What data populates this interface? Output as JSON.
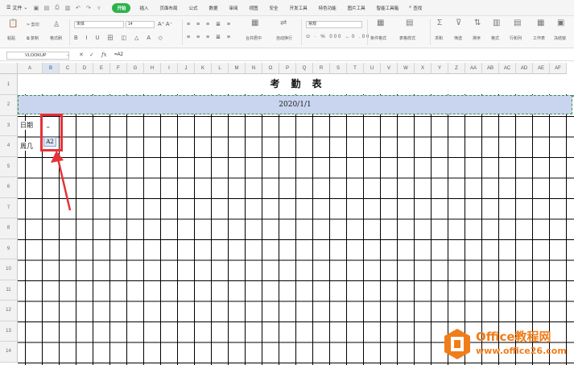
{
  "menubar": {
    "file_label": "文件",
    "tabs": [
      "开始",
      "插入",
      "页面布局",
      "公式",
      "数据",
      "审阅",
      "视图",
      "安全",
      "开发工具",
      "特色功能",
      "图片工具",
      "智能工具箱"
    ],
    "active_tab_index": 0,
    "search_label": "查找"
  },
  "ribbon": {
    "paste_label": "粘贴",
    "cut_label": "剪切",
    "copy_label": "复制",
    "format_painter_label": "格式刷",
    "font_name": "宋体",
    "font_size": "14",
    "merge_label": "合并居中",
    "wrap_label": "自动换行",
    "number_format": "常规",
    "cond_format_label": "条件格式",
    "table_style_label": "表格样式",
    "sum_label": "求和",
    "filter_label": "筛选",
    "sort_label": "排序",
    "format_label": "格式",
    "rowcol_label": "行和列",
    "worksheet_label": "工作表",
    "freeze_label": "冻结窗"
  },
  "formula_bar": {
    "name_box": "VLOOKUP",
    "formula": "=A2"
  },
  "columns": [
    "A",
    "B",
    "C",
    "D",
    "E",
    "F",
    "G",
    "H",
    "I",
    "J",
    "K",
    "L",
    "M",
    "N",
    "O",
    "P",
    "Q",
    "R",
    "S",
    "T",
    "U",
    "V",
    "W",
    "X",
    "Y",
    "Z",
    "AA",
    "AB",
    "AC",
    "AD",
    "AE",
    "AF"
  ],
  "selected_column": "B",
  "rows": [
    "1",
    "2",
    "3",
    "4",
    "5",
    "6",
    "7",
    "8",
    "9",
    "10",
    "11",
    "12",
    "13",
    "14"
  ],
  "cells": {
    "title": "考勤表",
    "date": "2020/1/1",
    "a3": "日期",
    "a4": "周几",
    "b3": "=",
    "b4": "A2"
  },
  "watermark": {
    "brand": "Office教程网",
    "url": "www.office26.com"
  },
  "colors": {
    "active_tab": "#2bb24c",
    "date_fill": "#c9d5ef",
    "highlight": "#e53238",
    "watermark": "#f07d1a"
  }
}
